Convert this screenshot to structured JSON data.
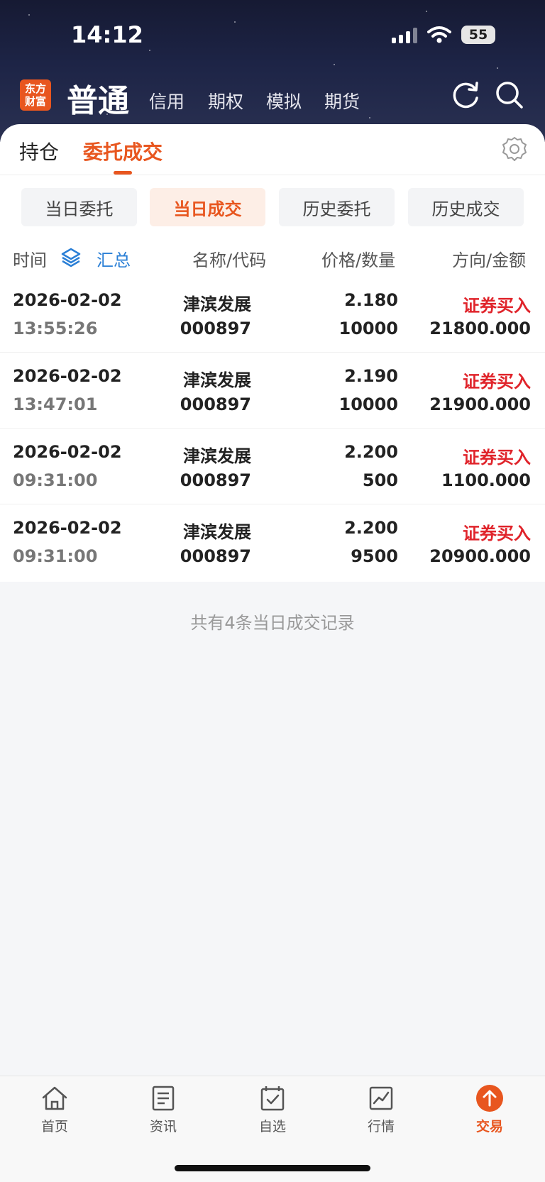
{
  "status": {
    "time": "14:12",
    "battery": "55"
  },
  "header": {
    "logo_line1": "东方",
    "logo_line2": "财富",
    "main_tab": "普通",
    "sub_tabs": [
      "信用",
      "期权",
      "模拟",
      "期货"
    ]
  },
  "tabs": {
    "position": "持仓",
    "orders": "委托成交"
  },
  "segments": [
    "当日委托",
    "当日成交",
    "历史委托",
    "历史成交"
  ],
  "columns": {
    "time": "时间",
    "summary": "汇总",
    "name_code": "名称/代码",
    "price_qty": "价格/数量",
    "dir_amount": "方向/金额"
  },
  "trades": [
    {
      "date": "2026-02-02",
      "time": "13:55:26",
      "name": "津滨发展",
      "code": "000897",
      "price": "2.180",
      "qty": "10000",
      "direction": "证券买入",
      "amount": "21800.000"
    },
    {
      "date": "2026-02-02",
      "time": "13:47:01",
      "name": "津滨发展",
      "code": "000897",
      "price": "2.190",
      "qty": "10000",
      "direction": "证券买入",
      "amount": "21900.000"
    },
    {
      "date": "2026-02-02",
      "time": "09:31:00",
      "name": "津滨发展",
      "code": "000897",
      "price": "2.200",
      "qty": "500",
      "direction": "证券买入",
      "amount": "1100.000"
    },
    {
      "date": "2026-02-02",
      "time": "09:31:00",
      "name": "津滨发展",
      "code": "000897",
      "price": "2.200",
      "qty": "9500",
      "direction": "证券买入",
      "amount": "20900.000"
    }
  ],
  "footer_note": "共有4条当日成交记录",
  "bottom_nav": [
    "首页",
    "资讯",
    "自选",
    "行情",
    "交易"
  ],
  "colors": {
    "accent": "#e8561f",
    "buy": "#e0242b",
    "link": "#2a7fd6"
  }
}
